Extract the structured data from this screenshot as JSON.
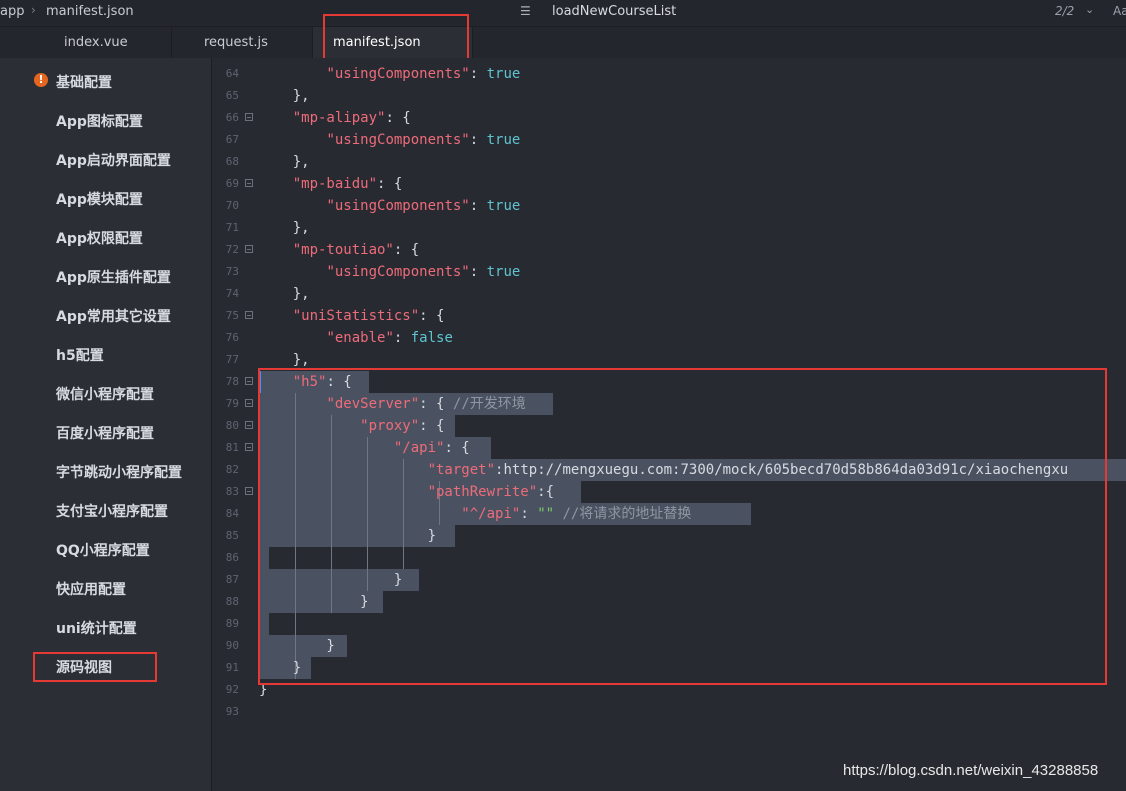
{
  "breadcrumb": {
    "root": "app",
    "file": "manifest.json"
  },
  "outline": {
    "icon": "outline-list-icon",
    "current_symbol": "loadNewCourseList",
    "counter": "2/2",
    "case_toggle": "Aa"
  },
  "tabs": [
    {
      "label": "index.vue",
      "active": false
    },
    {
      "label": "request.js",
      "active": false
    },
    {
      "label": "manifest.json",
      "active": true
    }
  ],
  "sidebar": {
    "items": [
      {
        "label": "基础配置",
        "warning": true
      },
      {
        "label": "App图标配置"
      },
      {
        "label": "App启动界面配置"
      },
      {
        "label": "App模块配置"
      },
      {
        "label": "App权限配置"
      },
      {
        "label": "App原生插件配置"
      },
      {
        "label": "App常用其它设置"
      },
      {
        "label": "h5配置"
      },
      {
        "label": "微信小程序配置"
      },
      {
        "label": "百度小程序配置"
      },
      {
        "label": "字节跳动小程序配置"
      },
      {
        "label": "支付宝小程序配置"
      },
      {
        "label": "QQ小程序配置"
      },
      {
        "label": "快应用配置"
      },
      {
        "label": "uni统计配置"
      },
      {
        "label": "源码视图",
        "active": true
      }
    ]
  },
  "editor": {
    "lines": [
      {
        "n": "64",
        "fold": false,
        "text": "        \"usingComponents\": true"
      },
      {
        "n": "65",
        "fold": false,
        "text": "    },"
      },
      {
        "n": "66",
        "fold": true,
        "text": "    \"mp-alipay\": {"
      },
      {
        "n": "67",
        "fold": false,
        "text": "        \"usingComponents\": true"
      },
      {
        "n": "68",
        "fold": false,
        "text": "    },"
      },
      {
        "n": "69",
        "fold": true,
        "text": "    \"mp-baidu\": {"
      },
      {
        "n": "70",
        "fold": false,
        "text": "        \"usingComponents\": true"
      },
      {
        "n": "71",
        "fold": false,
        "text": "    },"
      },
      {
        "n": "72",
        "fold": true,
        "text": "    \"mp-toutiao\": {"
      },
      {
        "n": "73",
        "fold": false,
        "text": "        \"usingComponents\": true"
      },
      {
        "n": "74",
        "fold": false,
        "text": "    },"
      },
      {
        "n": "75",
        "fold": true,
        "text": "    \"uniStatistics\": {"
      },
      {
        "n": "76",
        "fold": false,
        "text": "        \"enable\": false"
      },
      {
        "n": "77",
        "fold": false,
        "text": "    },"
      },
      {
        "n": "78",
        "fold": true,
        "text": "    \"h5\": {"
      },
      {
        "n": "79",
        "fold": true,
        "text": "        \"devServer\": { //开发环境"
      },
      {
        "n": "80",
        "fold": true,
        "text": "            \"proxy\": {"
      },
      {
        "n": "81",
        "fold": true,
        "text": "                \"/api\": {"
      },
      {
        "n": "82",
        "fold": false,
        "text": "                    \"target\":\"http://mengxuegu.com:7300/mock/605becd70d58b864da03d91c/xiaochengxu"
      },
      {
        "n": "83",
        "fold": true,
        "text": "                    \"pathRewrite\":{"
      },
      {
        "n": "84",
        "fold": false,
        "text": "                        \"^/api\": \"\" //将请求的地址替换"
      },
      {
        "n": "85",
        "fold": false,
        "text": "                    }"
      },
      {
        "n": "86",
        "fold": false,
        "text": ""
      },
      {
        "n": "87",
        "fold": false,
        "text": "                }"
      },
      {
        "n": "88",
        "fold": false,
        "text": "            }"
      },
      {
        "n": "89",
        "fold": false,
        "text": ""
      },
      {
        "n": "90",
        "fold": false,
        "text": "        }"
      },
      {
        "n": "91",
        "fold": false,
        "text": "    }"
      },
      {
        "n": "92",
        "fold": false,
        "text": "}"
      },
      {
        "n": "93",
        "fold": false,
        "text": ""
      }
    ]
  },
  "watermark": "https://blog.csdn.net/weixin_43288858",
  "colors": {
    "highlight_box": "#e53935",
    "key": "#ee6b7a",
    "string": "#7fc96b",
    "boolean": "#5fc4d0",
    "warning": "#e5661f"
  }
}
